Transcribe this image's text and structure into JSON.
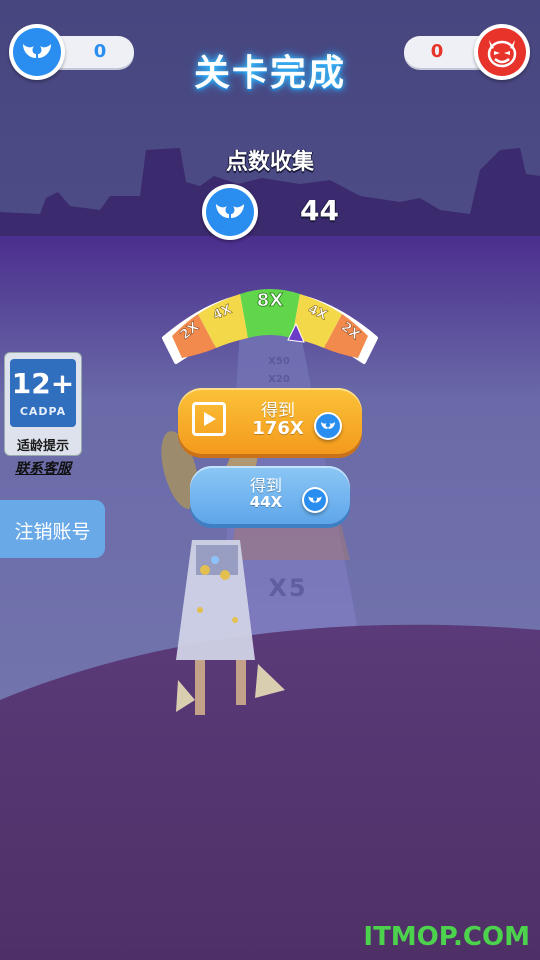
{
  "header": {
    "title": "关卡完成",
    "player_score": "0",
    "enemy_score": "0"
  },
  "result": {
    "heading": "点数收集",
    "count": "44"
  },
  "multiplier_meter": {
    "segments": [
      "2X",
      "4X",
      "8X",
      "4X",
      "2X"
    ],
    "colors": [
      "#f28a4e",
      "#f3d84a",
      "#62d64a",
      "#f3d84a",
      "#f28a4e"
    ]
  },
  "buttons": {
    "video_line1": "得到",
    "video_line2": "176X",
    "normal_line1": "得到",
    "normal_line2": "44X"
  },
  "track": {
    "marker_small1": "X50",
    "marker_small2": "X20",
    "marker_big": "X5"
  },
  "age_rating": {
    "number": "12+",
    "org": "CADPA",
    "label": "适龄提示"
  },
  "links": {
    "contact": "联系客服",
    "logout": "注销账号"
  },
  "watermark": "ITMOP.COM",
  "colors": {
    "accent_blue": "#2a8ef0",
    "enemy_red": "#e8332a",
    "video_button": "#f7a823",
    "normal_button": "#6fb6f0"
  }
}
